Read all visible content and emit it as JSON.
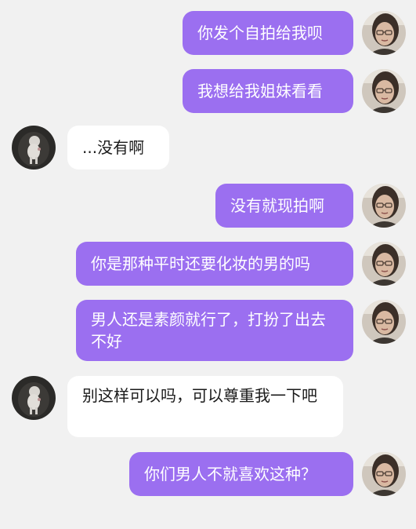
{
  "messages": [
    {
      "direction": "out",
      "text": "你发个自拍给我呗"
    },
    {
      "direction": "out",
      "text": "我想给我姐妹看看"
    },
    {
      "direction": "in",
      "text": "...没有啊"
    },
    {
      "direction": "out",
      "text": "没有就现拍啊"
    },
    {
      "direction": "out",
      "text": "你是那种平时还要化妆的男的吗"
    },
    {
      "direction": "out",
      "text": "男人还是素颜就行了，打扮了出去不好"
    },
    {
      "direction": "in",
      "text": "别这样可以吗，可以尊重我一下吧"
    },
    {
      "direction": "out",
      "text": "你们男人不就喜欢这种？"
    }
  ],
  "avatars": {
    "self": "woman-with-glasses-avatar",
    "contact": "white-figure-dark-avatar"
  },
  "colors": {
    "background": "#f1f1f1",
    "outgoing_bubble": "#9b6ff0",
    "incoming_bubble": "#ffffff"
  }
}
